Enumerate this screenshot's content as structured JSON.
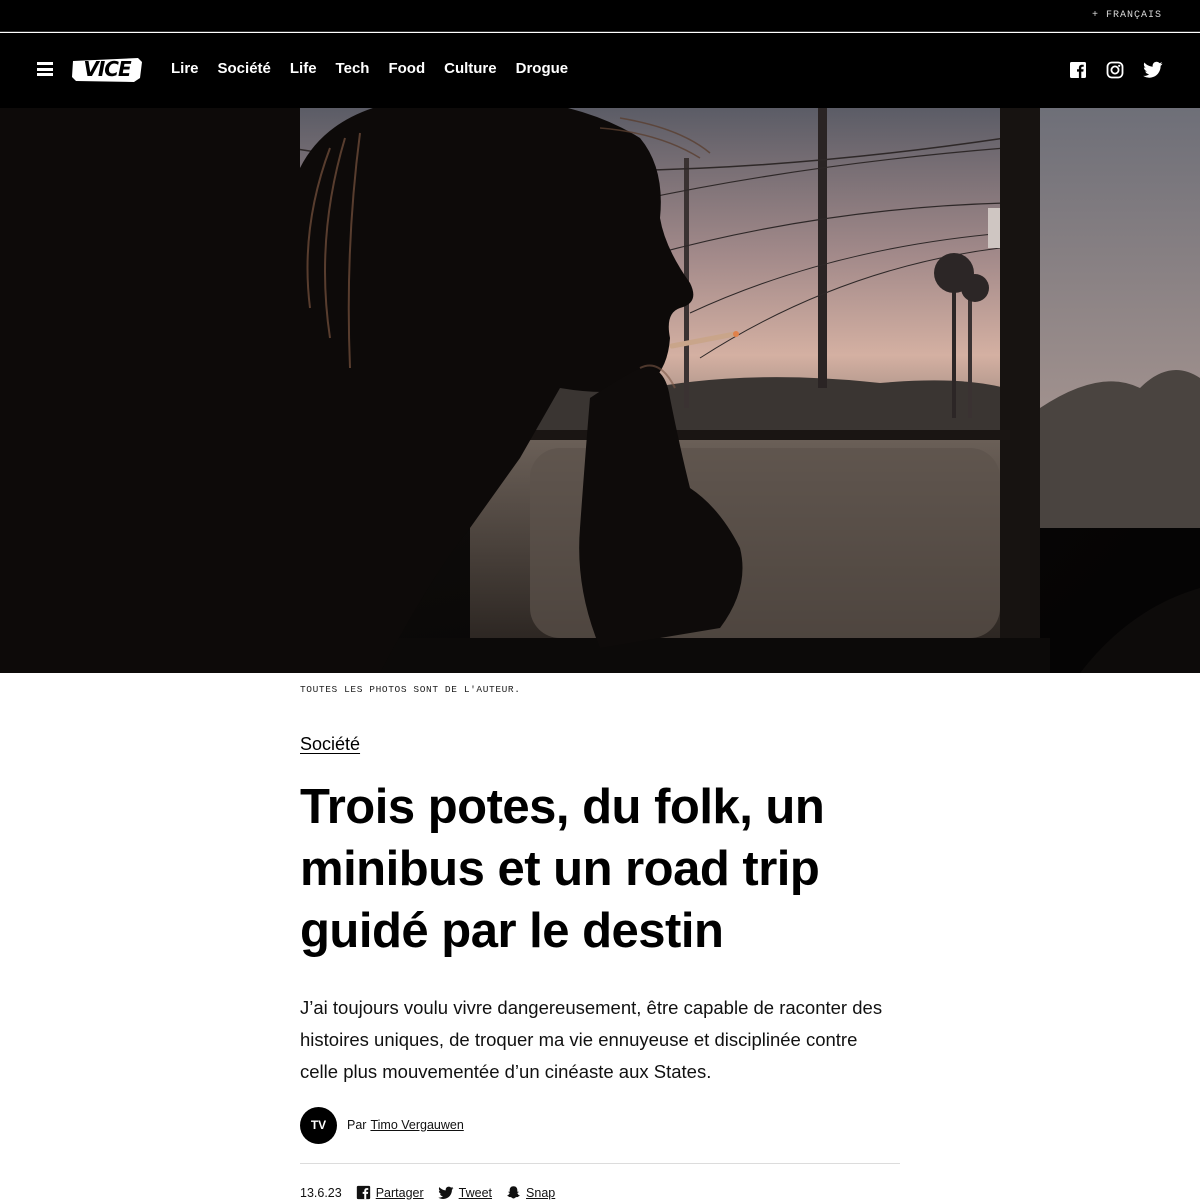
{
  "top_bar": {
    "language_link": "+ FRANÇAIS"
  },
  "nav": {
    "logo_text": "VICE",
    "links": [
      "Lire",
      "Société",
      "Life",
      "Tech",
      "Food",
      "Culture",
      "Drogue"
    ],
    "social": [
      "facebook-icon",
      "instagram-icon",
      "twitter-icon"
    ]
  },
  "hero": {
    "caption": "TOUTES LES PHOTOS SONT DE L'AUTEUR."
  },
  "article": {
    "section": "Société",
    "headline": "Trois potes, du folk, un minibus et un road trip guidé par le destin",
    "dek": "J’ai toujours voulu vivre dangereusement, être capable de raconter des histoires uniques, de troquer ma vie ennuyeuse et disciplinée contre celle plus mouvementée d’un cinéaste aux States.",
    "byline": {
      "avatar_initials": "TV",
      "prefix": "Par",
      "author": "Timo Vergauwen"
    },
    "date": "13.6.23",
    "share": {
      "facebook": "Partager",
      "twitter": "Tweet",
      "snapchat": "Snap"
    }
  },
  "colors": {
    "background": "#ffffff",
    "nav_bg": "#000000",
    "text": "#000000",
    "rule": "#dcdcdc"
  }
}
